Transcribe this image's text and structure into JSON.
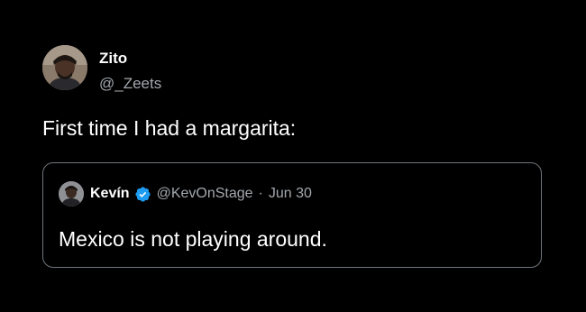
{
  "tweet": {
    "author": {
      "name": "Zito",
      "handle": "@_Zeets"
    },
    "text": "First time I had a margarita:",
    "quoted_tweet": {
      "author": {
        "name": "Kevín",
        "handle": "@KevOnStage",
        "verified": true
      },
      "separator": "·",
      "date": "Jun 30",
      "text": "Mexico is not playing around."
    }
  },
  "colors": {
    "background": "#000000",
    "primary_text": "#ffffff",
    "secondary_text": "#a3a8ad",
    "border": "#6f767d",
    "verified_badge": "#1d9bf0"
  },
  "icons": {
    "verified": "verified-badge-icon"
  }
}
